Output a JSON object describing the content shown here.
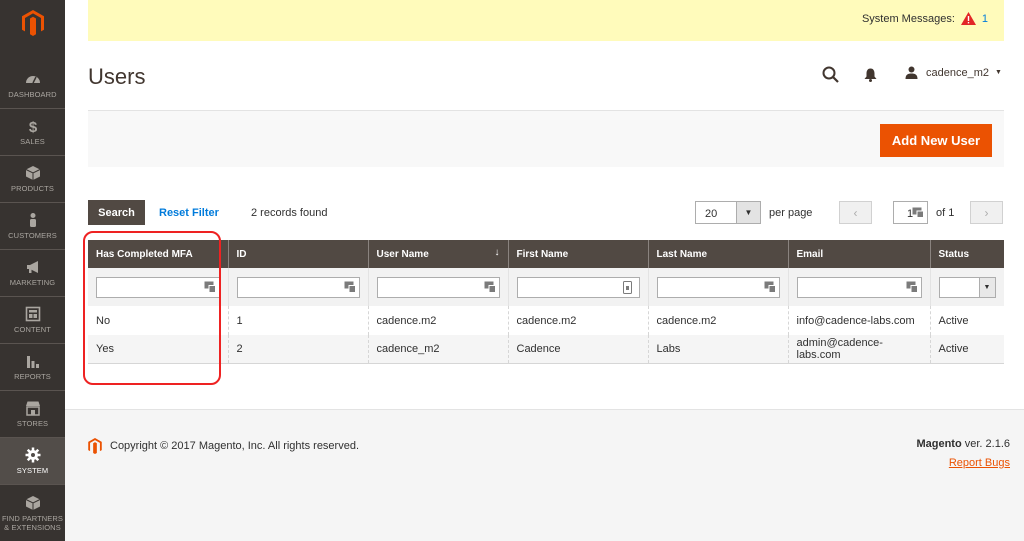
{
  "sidebar": {
    "items": [
      {
        "label": "DASHBOARD",
        "icon": "dashboard-icon"
      },
      {
        "label": "SALES",
        "icon": "dollar-icon"
      },
      {
        "label": "PRODUCTS",
        "icon": "box-icon"
      },
      {
        "label": "CUSTOMERS",
        "icon": "person-icon"
      },
      {
        "label": "MARKETING",
        "icon": "megaphone-icon"
      },
      {
        "label": "CONTENT",
        "icon": "layout-icon"
      },
      {
        "label": "REPORTS",
        "icon": "bar-chart-icon"
      },
      {
        "label": "STORES",
        "icon": "store-icon"
      },
      {
        "label": "SYSTEM",
        "icon": "gear-icon"
      },
      {
        "label": "FIND PARTNERS & EXTENSIONS",
        "icon": "cube-icon"
      }
    ],
    "active": "SYSTEM"
  },
  "system_messages": {
    "label": "System Messages:",
    "count": "1"
  },
  "header": {
    "title": "Users",
    "username": "cadence_m2"
  },
  "actions": {
    "add_label": "Add New User"
  },
  "toolbar": {
    "search_label": "Search",
    "reset_label": "Reset Filter",
    "records": "2 records found",
    "per_page_value": "20",
    "per_page_label": "per page",
    "page_value": "1",
    "page_of": "of 1"
  },
  "table": {
    "columns": [
      "Has Completed MFA",
      "ID",
      "User Name",
      "First Name",
      "Last Name",
      "Email",
      "Status"
    ],
    "sort_indicator": "↓",
    "rows": [
      [
        "No",
        "1",
        "cadence.m2",
        "cadence.m2",
        "cadence.m2",
        "info@cadence-labs.com",
        "Active"
      ],
      [
        "Yes",
        "2",
        "cadence_m2",
        "Cadence",
        "Labs",
        "admin@cadence-labs.com",
        "Active"
      ]
    ]
  },
  "footer": {
    "copyright": "Copyright © 2017 Magento, Inc. All rights reserved.",
    "version_brand": "Magento",
    "version_text": " ver. 2.1.6",
    "report_bugs": "Report Bugs"
  },
  "colors": {
    "accent": "#eb5202",
    "header_dark": "#514943",
    "sidebar": "#373330",
    "link": "#007bdb",
    "highlight": "#ee2222"
  }
}
